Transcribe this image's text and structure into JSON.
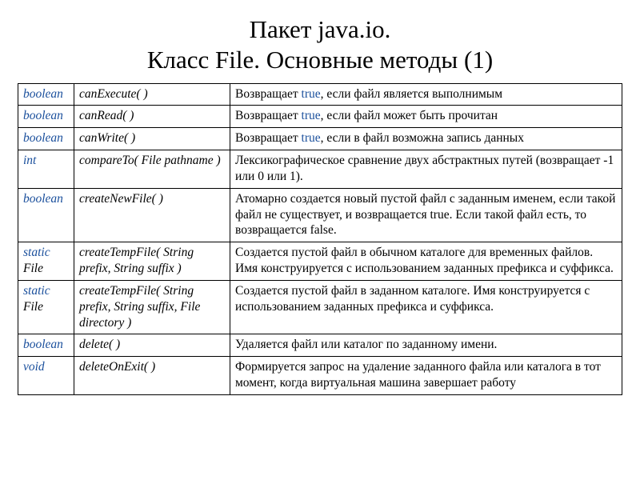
{
  "title_line1": "Пакет java.io.",
  "title_line2": "Класс File. Основные методы (1)",
  "keyword_true": "true",
  "rows": [
    {
      "ret_kw": "boolean",
      "ret_plain": "",
      "sig": "canExecute( )",
      "desc_pre": "Возвращает ",
      "desc_true": "true",
      "desc_post": ", если файл является выполнимым"
    },
    {
      "ret_kw": "boolean",
      "ret_plain": "",
      "sig": "canRead( )",
      "desc_pre": "Возвращает ",
      "desc_true": "true",
      "desc_post": ", если файл может быть прочитан"
    },
    {
      "ret_kw": "boolean",
      "ret_plain": "",
      "sig": "canWrite( )",
      "desc_pre": "Возвращает ",
      "desc_true": "true",
      "desc_post": ", если в файл возможна запись данных"
    },
    {
      "ret_kw": "int",
      "ret_plain": "",
      "sig": "compareTo( File pathname )",
      "desc_pre": "Лексикографическое сравнение двух абстрактных путей (возвращает -1 или 0 или 1).",
      "desc_true": "",
      "desc_post": ""
    },
    {
      "ret_kw": "boolean",
      "ret_plain": "",
      "sig": "createNewFile( )",
      "desc_pre": "Атомарно создается новый пустой файл с заданным именем, если такой файл не существует, и возвращается true. Если такой файл есть, то возвращается false.",
      "desc_true": "",
      "desc_post": ""
    },
    {
      "ret_kw": "static",
      "ret_plain": " File",
      "sig": "createTempFile( String prefix, String suffix )",
      "desc_pre": "Создается пустой файл в обычном каталоге для временных файлов. Имя конструируется с использованием заданных префикса и суффикса.",
      "desc_true": "",
      "desc_post": ""
    },
    {
      "ret_kw": "static",
      "ret_plain": " File",
      "sig": "createTempFile( String prefix, String suffix, File directory )",
      "desc_pre": "Создается пустой файл в заданном каталоге. Имя конструируется с использованием заданных префикса и суффикса.",
      "desc_true": "",
      "desc_post": ""
    },
    {
      "ret_kw": "boolean",
      "ret_plain": "",
      "sig": "delete( )",
      "desc_pre": "Удаляется файл или каталог по заданному имени.",
      "desc_true": "",
      "desc_post": ""
    },
    {
      "ret_kw": "void",
      "ret_plain": "",
      "sig": "deleteOnExit( )",
      "desc_pre": "Формируется запрос на удаление заданного файла или каталога в тот момент, когда виртуальная машина завершает работу",
      "desc_true": "",
      "desc_post": ""
    }
  ]
}
